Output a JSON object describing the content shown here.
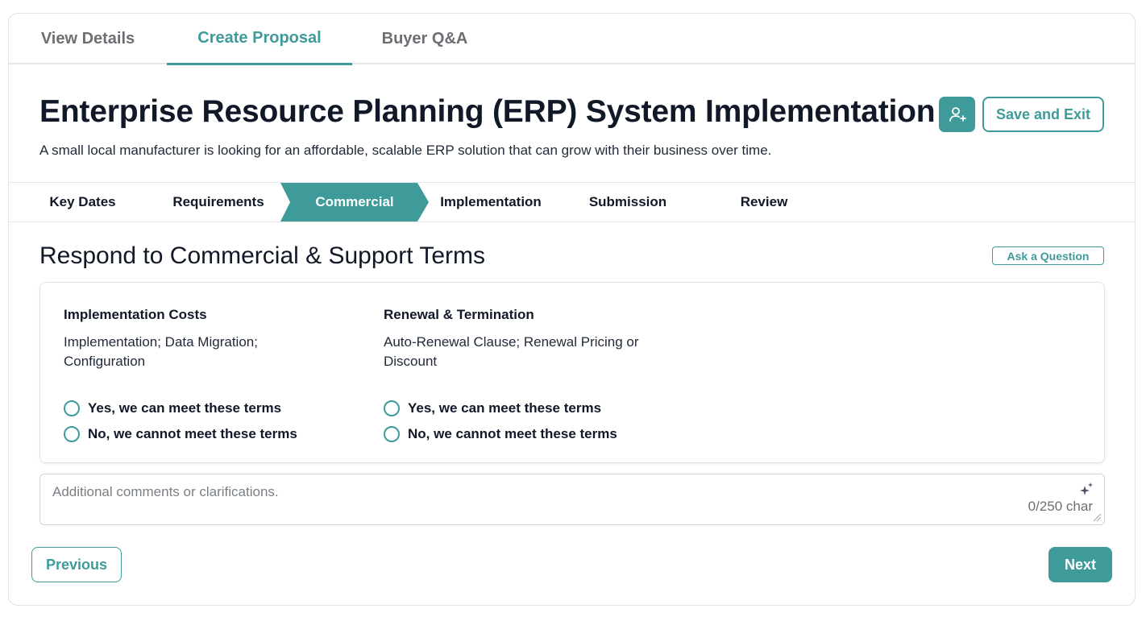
{
  "top_tabs": [
    {
      "label": "View Details",
      "active": false
    },
    {
      "label": "Create Proposal",
      "active": true
    },
    {
      "label": "Buyer Q&A",
      "active": false
    }
  ],
  "header": {
    "title": "Enterprise Resource Planning (ERP) System Implementation",
    "subtitle": "A small local manufacturer is looking for an affordable, scalable ERP solution that can grow with their business over time.",
    "add_user_icon": "add-user-icon",
    "save_label": "Save and Exit"
  },
  "steps": [
    {
      "label": "Key Dates",
      "active": false
    },
    {
      "label": "Requirements",
      "active": false
    },
    {
      "label": "Commercial",
      "active": true
    },
    {
      "label": "Implementation",
      "active": false
    },
    {
      "label": "Submission",
      "active": false
    },
    {
      "label": "Review",
      "active": false
    }
  ],
  "section": {
    "title": "Respond to Commercial & Support Terms",
    "ask_label": "Ask a Question"
  },
  "terms": [
    {
      "title": "Implementation Costs",
      "description": "Implementation; Data Migration; Configuration",
      "options": [
        "Yes, we can meet these terms",
        "No, we cannot meet these terms"
      ]
    },
    {
      "title": "Renewal & Termination",
      "description": "Auto-Renewal Clause; Renewal Pricing or Discount",
      "options": [
        "Yes, we can meet these terms",
        "No, we cannot meet these terms"
      ]
    }
  ],
  "comments": {
    "placeholder": "Additional comments or clarifications.",
    "counter": "0/250 char",
    "value": ""
  },
  "nav": {
    "previous_label": "Previous",
    "next_label": "Next"
  },
  "colors": {
    "accent": "#3e9b9a",
    "text": "#111827",
    "muted": "#6b6f73",
    "border": "#e3e7ea"
  }
}
